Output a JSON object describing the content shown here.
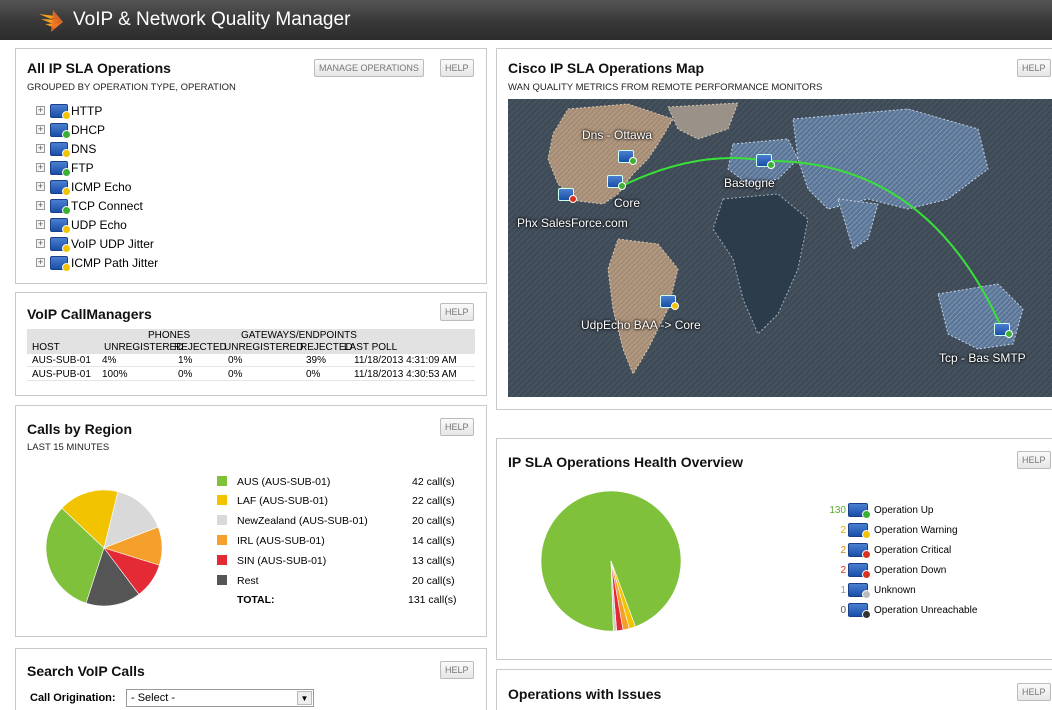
{
  "app": {
    "title": "VoIP & Network Quality Manager"
  },
  "sla_ops": {
    "title": "All IP SLA Operations",
    "subtitle": "GROUPED BY OPERATION TYPE, OPERATION",
    "manage_label": "MANAGE OPERATIONS",
    "help_label": "HELP",
    "items": [
      {
        "label": "HTTP",
        "status_color": "#f2c300"
      },
      {
        "label": "DHCP",
        "status_color": "#3cb034"
      },
      {
        "label": "DNS",
        "status_color": "#f2c300"
      },
      {
        "label": "FTP",
        "status_color": "#3cb034"
      },
      {
        "label": "ICMP Echo",
        "status_color": "#f2c300"
      },
      {
        "label": "TCP Connect",
        "status_color": "#3cb034"
      },
      {
        "label": "UDP Echo",
        "status_color": "#f2c300"
      },
      {
        "label": "VoIP UDP Jitter",
        "status_color": "#f2c300"
      },
      {
        "label": "ICMP Path Jitter",
        "status_color": "#f2c300"
      }
    ]
  },
  "callmanagers": {
    "title": "VoIP CallManagers",
    "help_label": "HELP",
    "group_phones": "PHONES",
    "group_gateways": "GATEWAYS/ENDPOINTS",
    "columns": [
      "HOST",
      "UNREGISTERED",
      "REJECTED",
      "UNREGISTERED",
      "REJECTED",
      "LAST POLL"
    ],
    "rows": [
      [
        "AUS-SUB-01",
        "4%",
        "1%",
        "0%",
        "39%",
        "11/18/2013 4:31:09 AM"
      ],
      [
        "AUS-PUB-01",
        "100%",
        "0%",
        "0%",
        "0%",
        "11/18/2013 4:30:53 AM"
      ]
    ]
  },
  "regions": {
    "title": "Calls by Region",
    "subtitle": "LAST 15 MINUTES",
    "help_label": "HELP",
    "legend": [
      {
        "label": "AUS (AUS-SUB-01)",
        "value": "42 call(s)",
        "color": "#7fc13a"
      },
      {
        "label": "LAF (AUS-SUB-01)",
        "value": "22 call(s)",
        "color": "#f2c300"
      },
      {
        "label": "NewZealand (AUS-SUB-01)",
        "value": "20 call(s)",
        "color": "#d9d9d9"
      },
      {
        "label": "IRL (AUS-SUB-01)",
        "value": "14 call(s)",
        "color": "#f5a02a"
      },
      {
        "label": "SIN (AUS-SUB-01)",
        "value": "13 call(s)",
        "color": "#e32a35"
      },
      {
        "label": "Rest",
        "value": "20 call(s)",
        "color": "#555555"
      }
    ],
    "total_label": "TOTAL:",
    "total_value": "131 call(s)",
    "pie_values": [
      42,
      22,
      20,
      14,
      13,
      20
    ]
  },
  "search": {
    "title": "Search VoIP Calls",
    "help_label": "HELP",
    "origination_label": "Call Origination:",
    "origination_value": "- Select -"
  },
  "map": {
    "title": "Cisco IP SLA Operations Map",
    "subtitle": "WAN QUALITY METRICS FROM REMOTE PERFORMANCE MONITORS",
    "help_label": "HELP",
    "labels": {
      "ottawa": "Dns - Ottawa",
      "core": "Core",
      "phx": "Phx SalesForce.com",
      "bastogne": "Bastogne",
      "udp": "UdpEcho BAA -> Core",
      "tcp": "Tcp - Bas SMTP"
    }
  },
  "health": {
    "title": "IP SLA Operations Health Overview",
    "help_label": "HELP",
    "rows": [
      {
        "count": "130",
        "label": "Operation Up",
        "count_color": "#5aaa2a",
        "dot": "#3cb034"
      },
      {
        "count": "2",
        "label": "Operation Warning",
        "count_color": "#e0a800",
        "dot": "#f2c300"
      },
      {
        "count": "2",
        "label": "Operation Critical",
        "count_color": "#e08000",
        "dot": "#d9301f"
      },
      {
        "count": "2",
        "label": "Operation Down",
        "count_color": "#d9301f",
        "dot": "#d9301f"
      },
      {
        "count": "1",
        "label": "Unknown",
        "count_color": "#999999",
        "dot": "#bbbbbb"
      },
      {
        "count": "0",
        "label": "Operation Unreachable",
        "count_color": "#555555",
        "dot": "#333333"
      }
    ],
    "pie_values": [
      130,
      2,
      2,
      2,
      1,
      0
    ],
    "pie_colors": [
      "#7fc13a",
      "#f2c300",
      "#f5a02a",
      "#e32a35",
      "#cccccc",
      "#333333"
    ]
  },
  "issues": {
    "title": "Operations with Issues",
    "help_label": "HELP"
  }
}
